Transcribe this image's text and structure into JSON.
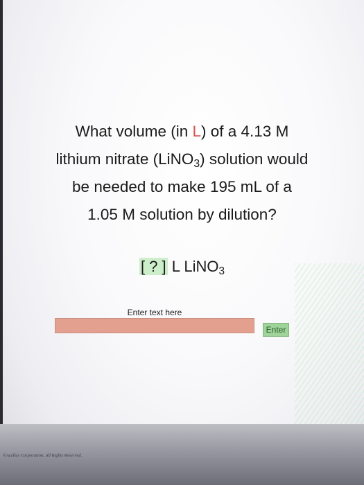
{
  "question": {
    "line1_a": "What volume (in ",
    "line1_unit": "L",
    "line1_b": ") of a 4.13 M",
    "line2_a": "lithium nitrate (LiNO",
    "line2_sub": "3",
    "line2_b": ") solution would",
    "line3": "be needed to make 195 mL of a",
    "line4": "1.05 M solution by dilution?"
  },
  "answer": {
    "blank": "[ ? ]",
    "unit_text": "L LiNO",
    "unit_sub": "3"
  },
  "input": {
    "label": "Enter text here",
    "value": "",
    "placeholder": ""
  },
  "buttons": {
    "enter_label": "Enter"
  },
  "footer": {
    "copyright": "©Acellus Corporation. All Rights Reserved."
  },
  "colors": {
    "accent": "#d9534f",
    "input_bg": "#e3a08f",
    "button_bg": "#9fd39a",
    "blank_bg": "#cdeecb"
  }
}
